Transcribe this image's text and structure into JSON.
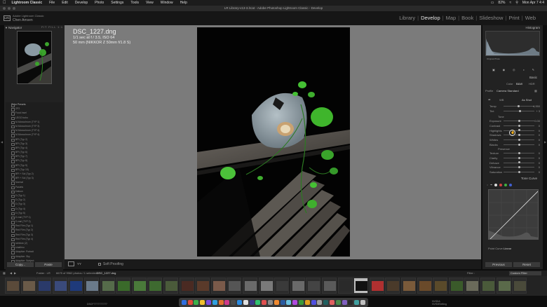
{
  "menubar": {
    "app": "Lightroom Classic",
    "items": [
      "File",
      "Edit",
      "Develop",
      "Photo",
      "Settings",
      "Tools",
      "View",
      "Window",
      "Help"
    ],
    "battery": "82%",
    "datetime": "Mon Apr 7  4:4"
  },
  "window": {
    "title": "LR Library-v13-3.lrcat - Adobe Photoshop Lightroom Classic - Develop"
  },
  "identity": {
    "logo": "LrC",
    "line1": "Adobe Lightroom Classic",
    "line2": "Chen Amsen"
  },
  "modules": [
    "Library",
    "Develop",
    "Map",
    "Book",
    "Slideshow",
    "Print",
    "Web"
  ],
  "active_module": "Develop",
  "left_panel": {
    "navigator_label": "Navigator",
    "zoom_options": "FIT  FILL  1:1",
    "presets": [
      "Color Presets",
      "ZP2",
      "Food Insel",
      "LEGO boho",
      "M-Monochrom (TYP 1)",
      "M-Monochrom (TYP 3)",
      "M-Monochrom (TYP 4)",
      "M-Monochrom (TYP 4)",
      "BPI (Typ 2)",
      "BPI (Typ 3)",
      "BPI (Typ 4)",
      "BPI (Typ 6)",
      "BPI (Typ 7)",
      "BPI (Typ 8)",
      "BPI (Typ 9)",
      "BPI (Typ 10)",
      "BPI + Sol (Typ 2)",
      "BPI + Sol (Typ 3)",
      "Normal",
      "Pastels",
      "Datsun",
      "D (Typ 1)",
      "D (Typ 2)",
      "D (Typ 3)",
      "D (Typ 4)",
      "D (Typ 5)",
      "D-mal (TYP 1)",
      "D-mal (TYP 2)",
      "Red Film (Typ 1)",
      "Red Film (Typ 2)",
      "Red Film (Typ 3)",
      "Red Film (Typ 4)",
      "rainbow (2)",
      "smallmu",
      "Adaptive: Portrait",
      "Adaptive: Sky",
      "Adaptive: Subject"
    ],
    "copy_label": "Copy...",
    "paste_label": "Paste"
  },
  "info_overlay": {
    "filename": "DSC_1227.dng",
    "line1": "1/1 sec at f / 3.5, ISO 64",
    "line2": "50 mm (NIKKOR Z 50mm f/1.8 S)"
  },
  "toolbar": {
    "yy_label": "YY",
    "soft_proofing_label": "Soft Proofing"
  },
  "right_panel": {
    "histogram_label": "Histogram",
    "original_photo_label": "Original Photo",
    "basic_label": "Basic",
    "treatment_options": [
      "Color",
      "B&W",
      "HDR"
    ],
    "profile_label": "Profile",
    "profile_value": "Camera Standard",
    "wb_label": "WB",
    "wb_value": "As Shot",
    "temp_label": "Temp",
    "temp_value": "4,950",
    "tint_label": "Tint",
    "tint_value": "+ 3",
    "tone_label": "Tone",
    "tone_sliders": [
      {
        "label": "Exposure",
        "value": "0.00",
        "pos": 0.5
      },
      {
        "label": "Contrast",
        "value": "0",
        "pos": 0.5
      },
      {
        "label": "Highlights",
        "value": "0",
        "pos": 0.5
      },
      {
        "label": "Shadows",
        "value": "0",
        "pos": 0.5
      },
      {
        "label": "Whites",
        "value": "0",
        "pos": 0.5
      },
      {
        "label": "Blacks",
        "value": "0",
        "pos": 0.5
      }
    ],
    "presence_label": "Presence",
    "presence_sliders": [
      {
        "label": "Texture",
        "value": "0",
        "pos": 0.5
      },
      {
        "label": "Clarity",
        "value": "0",
        "pos": 0.5
      },
      {
        "label": "Dehaze",
        "value": "0",
        "pos": 0.5
      },
      {
        "label": "Vibrance",
        "value": "0",
        "pos": 0.5
      },
      {
        "label": "Saturation",
        "value": "0",
        "pos": 0.5
      }
    ],
    "tone_curve_label": "Tone Curve",
    "point_curve_label": "Point Curve :",
    "point_curve_value": "Linear",
    "previous_label": "Previous",
    "reset_label": "Reset"
  },
  "filmstrip_bar": {
    "folder": "Folder : LR",
    "count_text": "6675 of 9962 photos / 1 selected /",
    "selected_file": "DSC_1227.dng",
    "filter_label": "Filter :",
    "filter_value": "Custom Filter"
  },
  "status": {
    "left": "DSCF7777777777",
    "right_line1": "NVIDIA",
    "right_line2": "NVSMSetting"
  }
}
